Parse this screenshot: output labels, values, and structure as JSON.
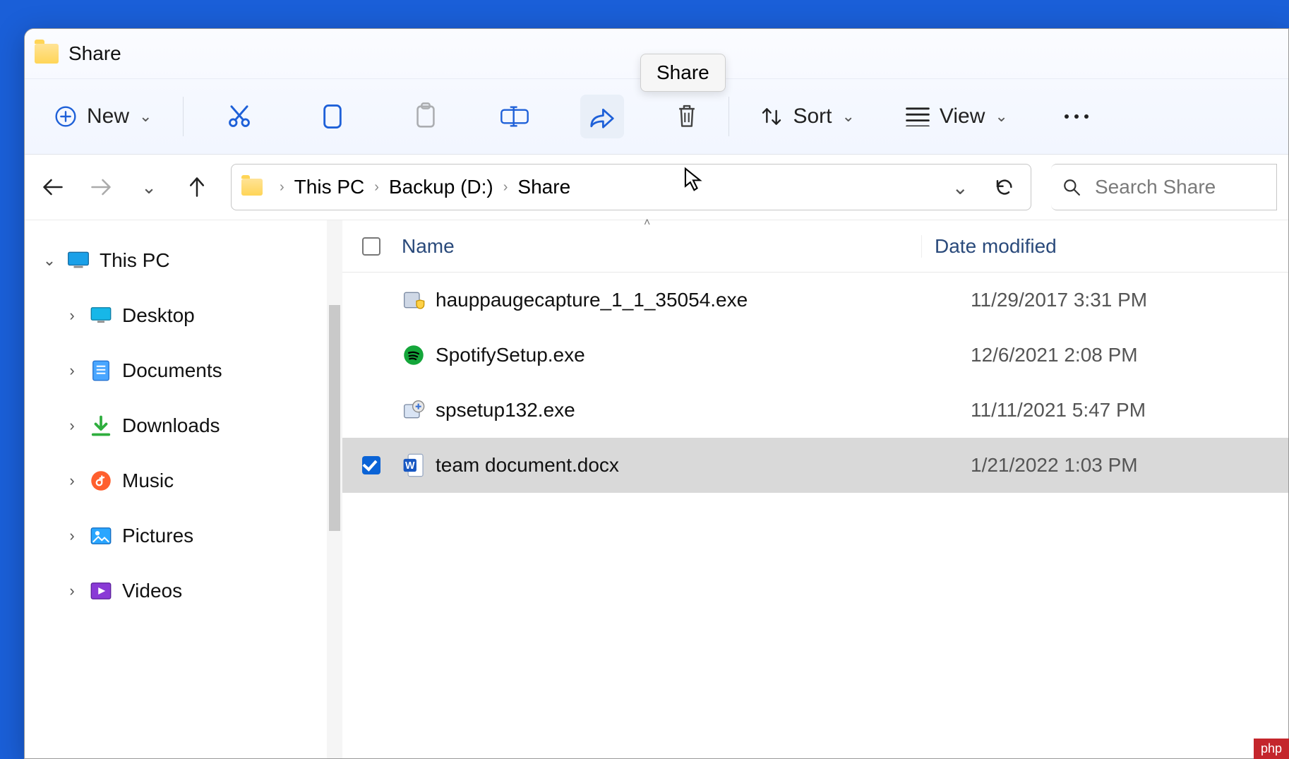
{
  "window": {
    "title": "Share"
  },
  "toolbar": {
    "new_label": "New",
    "sort_label": "Sort",
    "view_label": "View",
    "tooltip": "Share"
  },
  "breadcrumb": {
    "items": [
      "This PC",
      "Backup (D:)",
      "Share"
    ]
  },
  "search": {
    "placeholder": "Search Share"
  },
  "sidebar": {
    "root": "This PC",
    "items": [
      "Desktop",
      "Documents",
      "Downloads",
      "Music",
      "Pictures",
      "Videos"
    ]
  },
  "columns": {
    "name": "Name",
    "date": "Date modified"
  },
  "files": [
    {
      "name": "hauppaugecapture_1_1_35054.exe",
      "date": "11/29/2017 3:31 PM",
      "icon": "exe-shield",
      "selected": false
    },
    {
      "name": "SpotifySetup.exe",
      "date": "12/6/2021 2:08 PM",
      "icon": "spotify",
      "selected": false
    },
    {
      "name": "spsetup132.exe",
      "date": "11/11/2021 5:47 PM",
      "icon": "installer",
      "selected": false
    },
    {
      "name": "team document.docx",
      "date": "1/21/2022 1:03 PM",
      "icon": "word",
      "selected": true
    }
  ],
  "watermark": "php"
}
